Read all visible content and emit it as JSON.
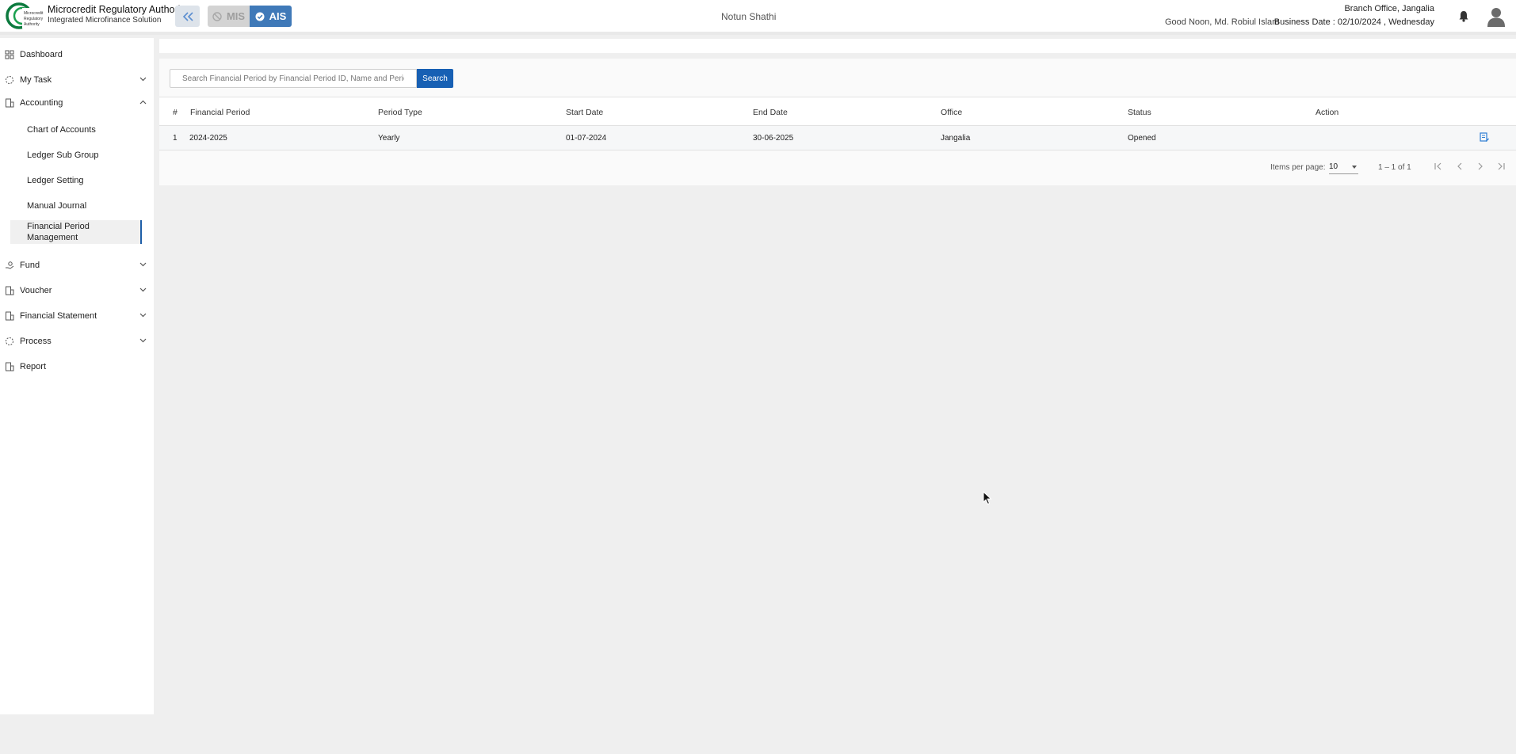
{
  "header": {
    "brand_title": "Microcredit Regulatory Authority",
    "brand_subtitle": "Integrated Microfinance Solution",
    "logo_text": "Microcredit Regulatory Authority",
    "mis_label": "MIS",
    "ais_label": "AIS",
    "center_title": "Notun Shathi",
    "greeting": "Good Noon, Md. Robiul Islam",
    "branch": "Branch Office, Jangalia",
    "business_date": "Business Date : 02/10/2024 , Wednesday"
  },
  "sidebar": {
    "items": [
      {
        "label": "Dashboard",
        "icon": "dashboard-icon"
      },
      {
        "label": "My Task",
        "icon": "task-icon"
      },
      {
        "label": "Accounting",
        "icon": "accounting-icon"
      },
      {
        "label": "Fund",
        "icon": "fund-icon"
      },
      {
        "label": "Voucher",
        "icon": "voucher-icon"
      },
      {
        "label": "Financial Statement",
        "icon": "statement-icon"
      },
      {
        "label": "Process",
        "icon": "process-icon"
      },
      {
        "label": "Report",
        "icon": "report-icon"
      }
    ],
    "accounting_sub": [
      {
        "label": "Chart of Accounts"
      },
      {
        "label": "Ledger Sub Group"
      },
      {
        "label": "Ledger Setting"
      },
      {
        "label": "Manual Journal"
      },
      {
        "label": "Financial Period Management",
        "active": true
      }
    ]
  },
  "search": {
    "placeholder": "Search Financial Period by Financial Period ID, Name and Period Type",
    "value": "",
    "button_label": "Search"
  },
  "table": {
    "columns": [
      "#",
      "Financial Period",
      "Period Type",
      "Start Date",
      "End Date",
      "Office",
      "Status",
      "Action"
    ],
    "rows": [
      [
        "1",
        "2024-2025",
        "Yearly",
        "01-07-2024",
        "30-06-2025",
        "Jangalia",
        "Opened"
      ]
    ]
  },
  "pagination": {
    "items_per_page_label": "Items per page:",
    "items_per_page": "10",
    "range": "1 – 1 of 1"
  },
  "colors": {
    "accent": "#1760b4",
    "ais_active": "#3f79b8",
    "active_indicator": "#1f5fa8"
  }
}
